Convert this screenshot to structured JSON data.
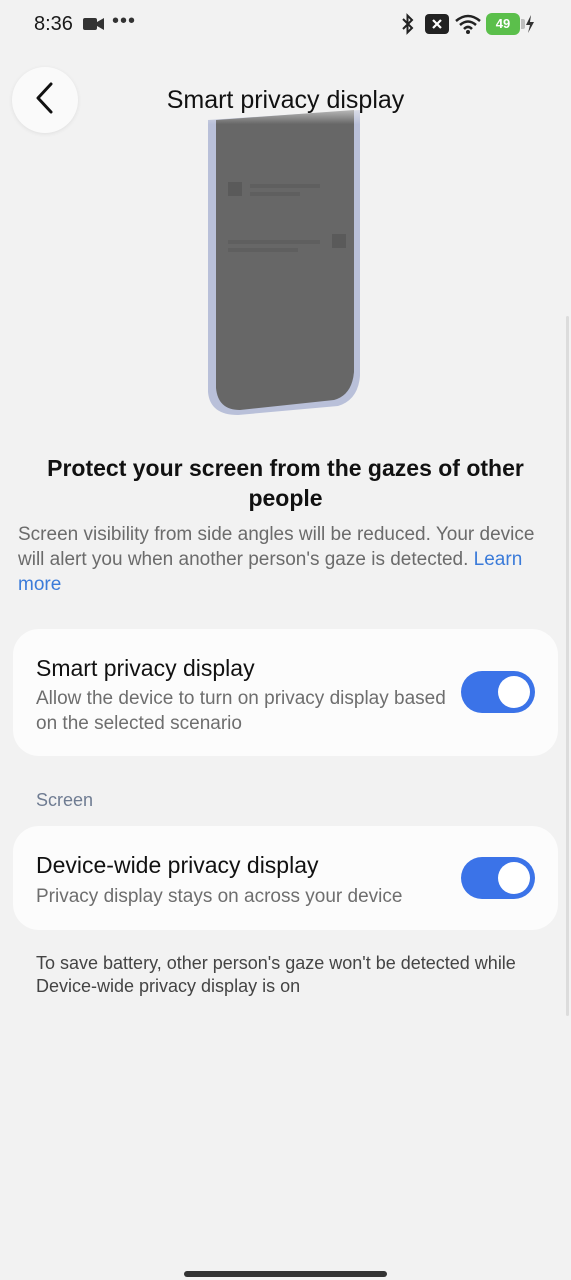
{
  "status_bar": {
    "time": "8:36",
    "battery_level": "49",
    "icons": [
      "video-icon",
      "more-dots-icon",
      "bluetooth-icon",
      "mute-icon",
      "wifi-icon",
      "battery-icon",
      "charging-icon"
    ]
  },
  "header": {
    "back_icon": "chevron-left-icon",
    "title": "Smart privacy display"
  },
  "intro": {
    "heading": "Protect your screen from the gazes of other people",
    "body": "Screen visibility from side angles will be reduced. Your device will alert you when another person's gaze is detected.",
    "learn_more": "Learn more"
  },
  "smart_privacy": {
    "title": "Smart privacy display",
    "subtitle": "Allow the device to turn on privacy display based on the selected scenario",
    "enabled": true
  },
  "section_screen": "Screen",
  "device_wide": {
    "title": "Device-wide privacy display",
    "subtitle": "Privacy display stays on across your device",
    "enabled": true
  },
  "footnote": "To save battery, other person's gaze won't be detected while Device-wide privacy display is on",
  "colors": {
    "background": "#f2f2f2",
    "card": "#fcfcfc",
    "accent": "#3b73e8",
    "link": "#3b7bd9",
    "battery": "#5bbf4b"
  }
}
